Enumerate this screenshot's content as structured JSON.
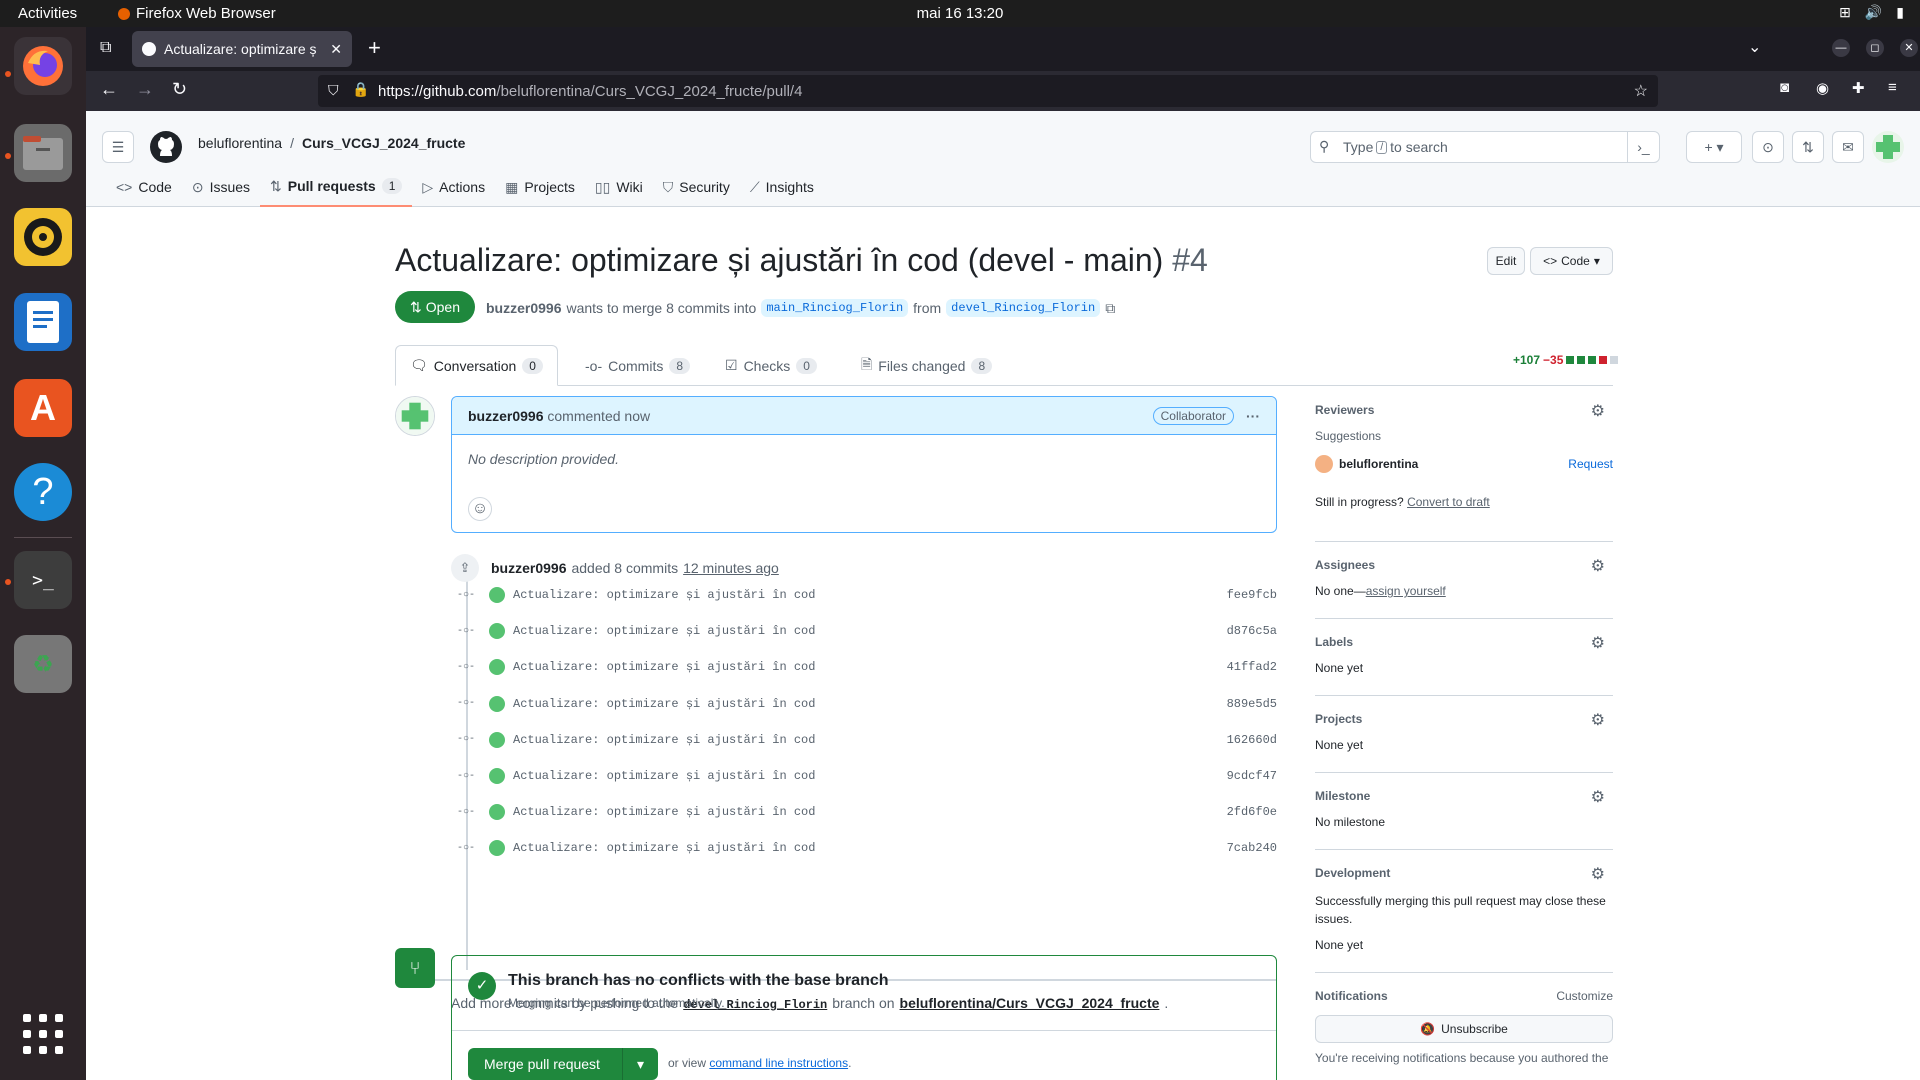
{
  "os": {
    "activities": "Activities",
    "app_name": "Firefox Web Browser",
    "clock": "mai 16  13:20"
  },
  "browser": {
    "tab_title": "Actualizare: optimizare ș",
    "url_host": "https://github.com",
    "url_path": "/beluflorentina/Curs_VCGJ_2024_fructe/pull/4"
  },
  "github": {
    "owner": "beluflorentina",
    "repo": "Curs_VCGJ_2024_fructe",
    "search_prefix": "Type",
    "search_key": "/",
    "search_suffix": "to search",
    "nav": {
      "code": "Code",
      "issues": "Issues",
      "pulls": "Pull requests",
      "pulls_count": "1",
      "actions": "Actions",
      "projects": "Projects",
      "wiki": "Wiki",
      "security": "Security",
      "insights": "Insights"
    }
  },
  "pr": {
    "title": "Actualizare: optimizare și ajustări în cod (devel - main)",
    "number": "#4",
    "edit": "Edit",
    "code": "Code",
    "state": "Open",
    "author": "buzzer0996",
    "merge_text": "wants to merge 8 commits into",
    "base_branch": "main_Rinciog_Florin",
    "from_text": "from",
    "head_branch": "devel_Rinciog_Florin",
    "tabs": {
      "conversation": "Conversation",
      "conversation_count": "0",
      "commits": "Commits",
      "commits_count": "8",
      "checks": "Checks",
      "checks_count": "0",
      "files": "Files changed",
      "files_count": "8"
    },
    "additions": "+107",
    "deletions": "−35",
    "comment": {
      "author": "buzzer0996",
      "time": "commented now",
      "badge": "Collaborator",
      "body": "No description provided."
    },
    "commit_event": {
      "author": "buzzer0996",
      "text": "added 8 commits",
      "time": "12 minutes ago"
    },
    "commits": [
      {
        "message": "Actualizare: optimizare și ajustări în cod",
        "sha": "fee9fcb"
      },
      {
        "message": "Actualizare: optimizare și ajustări în cod",
        "sha": "d876c5a"
      },
      {
        "message": "Actualizare: optimizare și ajustări în cod",
        "sha": "41ffad2"
      },
      {
        "message": "Actualizare: optimizare și ajustări în cod",
        "sha": "889e5d5"
      },
      {
        "message": "Actualizare: optimizare și ajustări în cod",
        "sha": "162660d"
      },
      {
        "message": "Actualizare: optimizare și ajustări în cod",
        "sha": "9cdcf47"
      },
      {
        "message": "Actualizare: optimizare și ajustări în cod",
        "sha": "2fd6f0e"
      },
      {
        "message": "Actualizare: optimizare și ajustări în cod",
        "sha": "7cab240"
      }
    ],
    "push_hint_1": "Add more commits by pushing to the",
    "push_hint_branch": "devel_Rinciog_Florin",
    "push_hint_2": "branch on",
    "push_hint_repo": "beluflorentina/Curs_VCGJ_2024_fructe",
    "merge_title": "This branch has no conflicts with the base branch",
    "merge_sub": "Merging can be performed automatically.",
    "merge_button": "Merge pull request",
    "or_view": "or view",
    "cli_link": "command line instructions"
  },
  "sidebar": {
    "reviewers": "Reviewers",
    "suggestions": "Suggestions",
    "suggested_reviewer": "beluflorentina",
    "request": "Request",
    "still_progress": "Still in progress?",
    "convert_draft": "Convert to draft",
    "assignees": "Assignees",
    "no_one": "No one—",
    "assign_yourself": "assign yourself",
    "labels": "Labels",
    "labels_value": "None yet",
    "projects": "Projects",
    "projects_value": "None yet",
    "milestone": "Milestone",
    "milestone_value": "No milestone",
    "development": "Development",
    "development_text": "Successfully merging this pull request may close these issues.",
    "development_value": "None yet",
    "notifications": "Notifications",
    "customize": "Customize",
    "unsubscribe": "Unsubscribe",
    "notif_text": "You're receiving notifications because you authored the"
  },
  "colors": {
    "accent_green": "#1f883d",
    "link_blue": "#0969da",
    "deletion_red": "#cf222e"
  }
}
